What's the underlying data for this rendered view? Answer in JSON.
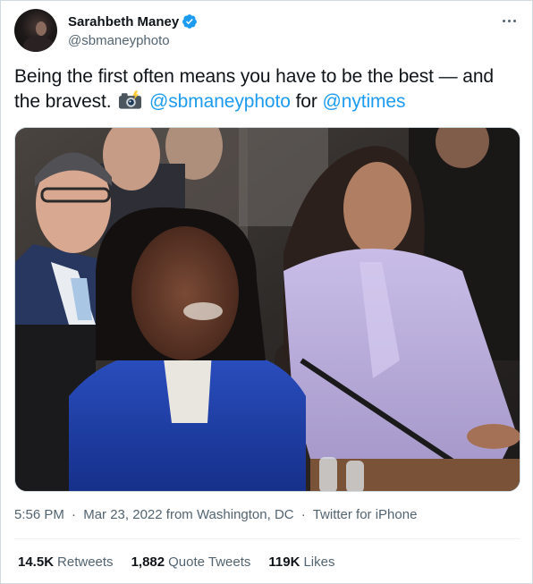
{
  "author": {
    "display_name": "Sarahbeth Maney",
    "handle": "@sbmaneyphoto",
    "verified": true
  },
  "tweet": {
    "text_part1": "Being the first often means you have to be the best — and the bravest.",
    "camera_emoji_icon": "camera-with-flash-icon",
    "mention_author": "@sbmaneyphoto",
    "text_for": "for",
    "mention_outlet": "@nytimes"
  },
  "photo": {
    "alt": ""
  },
  "meta": {
    "time": "5:56 PM",
    "date": "Mar 23, 2022",
    "location": "from Washington, DC",
    "source": "Twitter for iPhone",
    "separator": "·"
  },
  "stats": {
    "retweets_count": "14.5K",
    "retweets_label": "Retweets",
    "quotes_count": "1,882",
    "quotes_label": "Quote Tweets",
    "likes_count": "119K",
    "likes_label": "Likes"
  },
  "colors": {
    "accent": "#1d9bf0",
    "text_primary": "#0f1419",
    "text_secondary": "#536471",
    "border": "#cfd9de"
  },
  "icons": [
    "more-icon",
    "verified-badge-icon",
    "camera-with-flash-icon"
  ]
}
